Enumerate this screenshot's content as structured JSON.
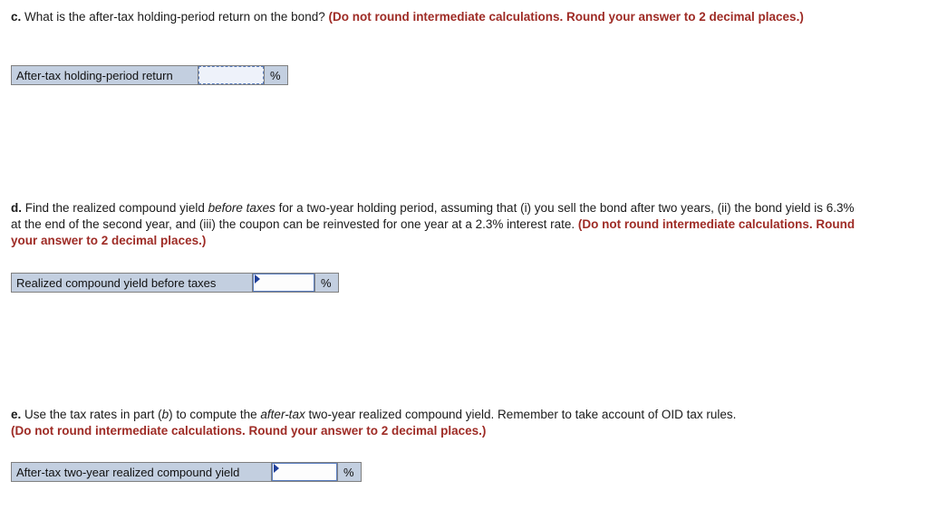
{
  "questions": [
    {
      "label": "c.",
      "text_part1": " What is the after-tax holding-period return on the bond? ",
      "bold_red": "(Do not round intermediate calculations. Round your answer to 2 decimal places.)",
      "answer_label": "After-tax holding-period return",
      "answer_value": "",
      "unit": "%"
    },
    {
      "label": "d.",
      "text_part1": " Find the realized compound yield ",
      "italic1": "before taxes",
      "text_part2": " for a two-year holding period, assuming that (i) you sell the bond after two years, (ii) the bond yield is 6.3% at the end of the second year, and (iii) the coupon can be reinvested for one year at a 2.3% interest rate. ",
      "bold_red": "(Do not round intermediate calculations. Round your answer to 2 decimal places.)",
      "answer_label": "Realized compound yield before taxes",
      "answer_value": "",
      "unit": "%"
    },
    {
      "label": "e.",
      "text_part1": " Use the tax rates in part (",
      "italic1": "b",
      "text_part2": ") to compute the ",
      "italic2": "after-tax",
      "text_part3": " two-year realized compound yield. Remember to take account of OID tax rules. ",
      "bold_red": "(Do not round intermediate calculations. Round your answer to 2 decimal places.)",
      "answer_label": "After-tax two-year realized compound yield",
      "answer_value": "",
      "unit": "%"
    }
  ],
  "colors": {
    "red_emphasis": "#9e2b25",
    "field_label_bg": "#c3cfe0",
    "field_border": "#808080",
    "input_border": "#5a7ec0",
    "caret": "#21409a"
  }
}
